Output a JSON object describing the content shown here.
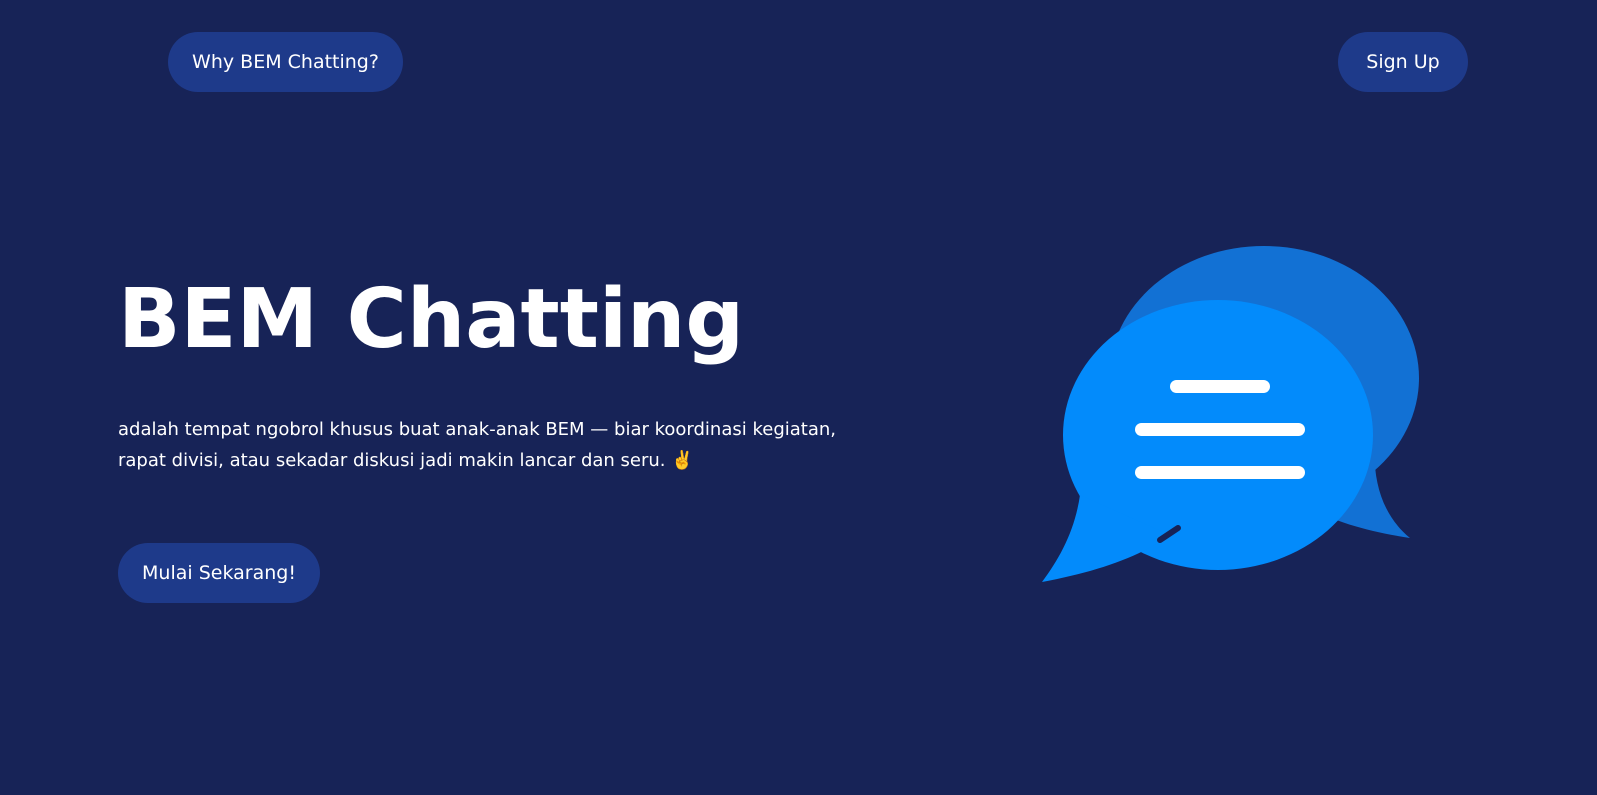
{
  "nav": {
    "why_label": "Why BEM Chatting?",
    "signup_label": "Sign Up"
  },
  "hero": {
    "title": "BEM Chatting",
    "description": "adalah tempat ngobrol khusus buat anak-anak BEM — biar koordinasi kegiatan, rapat divisi, atau sekadar diskusi jadi makin lancar dan seru. ✌️",
    "cta_label": "Mulai Sekarang!"
  },
  "illustration": {
    "icon": "chat-bubbles-icon"
  },
  "colors": {
    "background": "#172357",
    "button": "#1e3a8a",
    "bubble_back": "#1271d4",
    "bubble_front": "#038bfb",
    "text": "#ffffff"
  }
}
